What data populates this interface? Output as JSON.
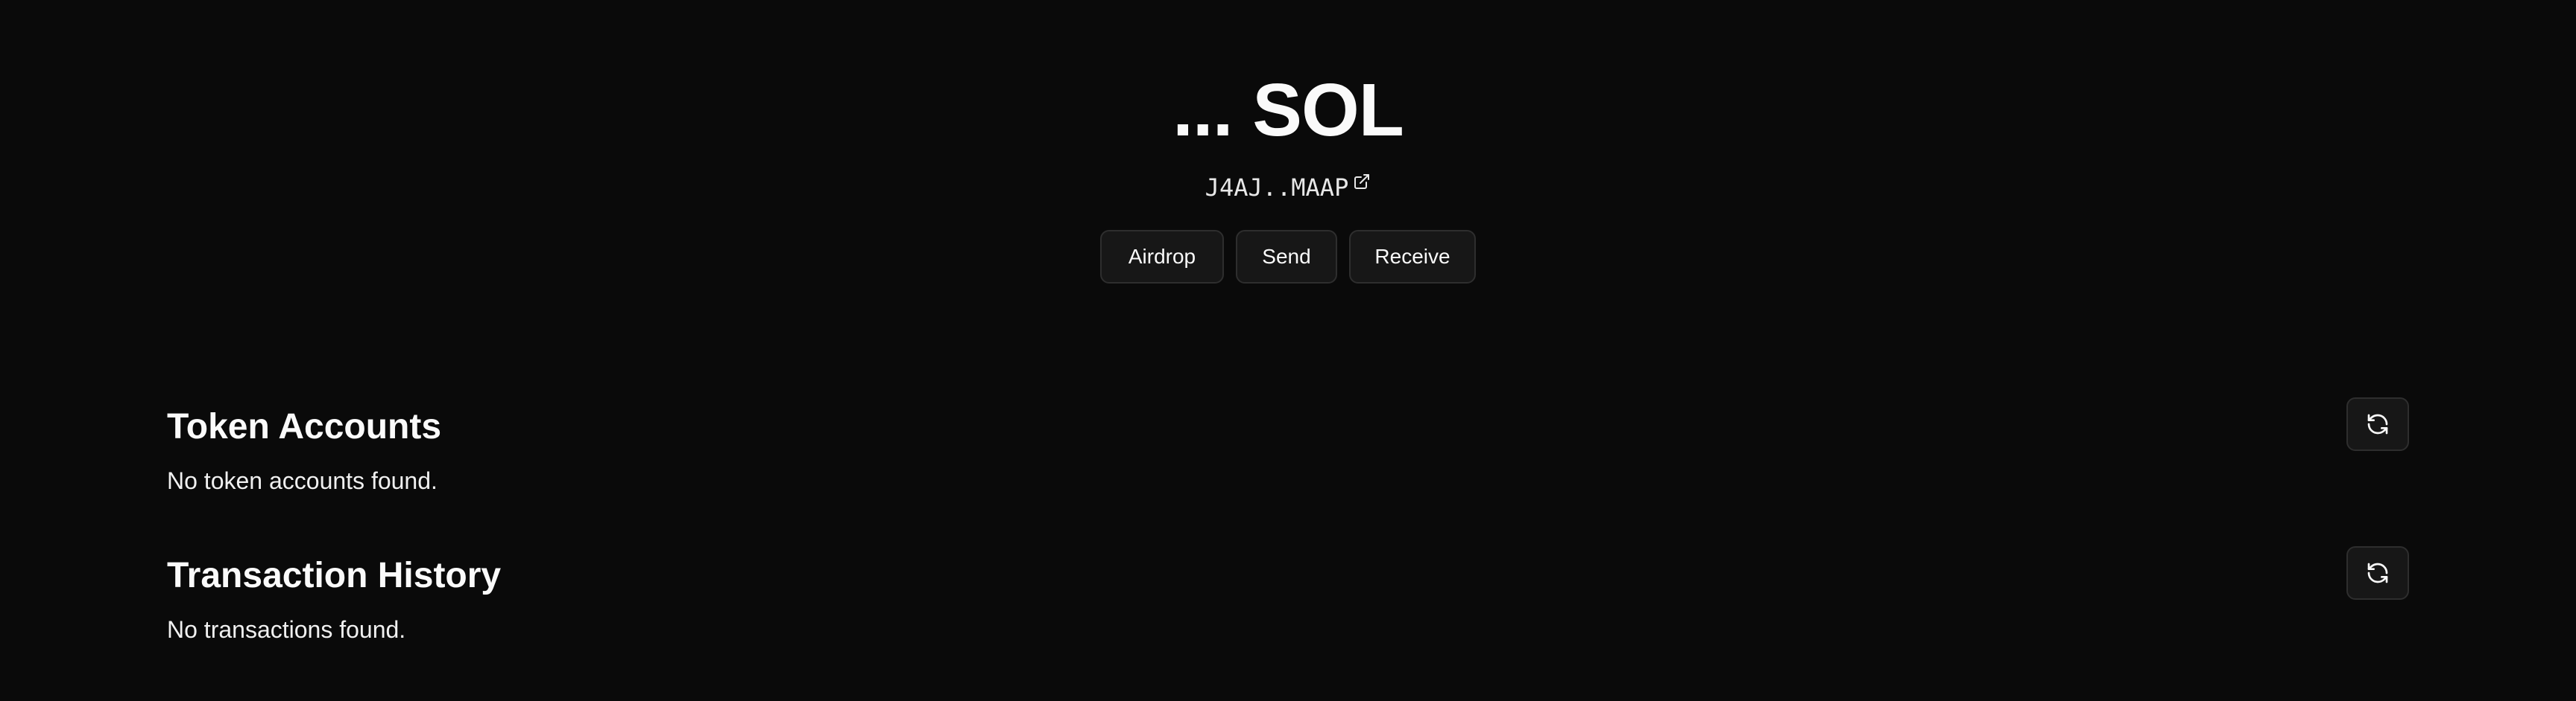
{
  "account": {
    "balance": "... SOL",
    "address": "J4AJ..MAAP"
  },
  "actions": {
    "airdrop": "Airdrop",
    "send": "Send",
    "receive": "Receive"
  },
  "token_accounts": {
    "title": "Token Accounts",
    "empty_message": "No token accounts found."
  },
  "transaction_history": {
    "title": "Transaction History",
    "empty_message": "No transactions found."
  },
  "icons": {
    "address_link": "external-link-icon",
    "refresh": "refresh-icon"
  },
  "colors": {
    "background": "#0a0a0a",
    "text": "#fafafa",
    "button_bg": "#171717",
    "button_border": "#2e2e2e"
  }
}
